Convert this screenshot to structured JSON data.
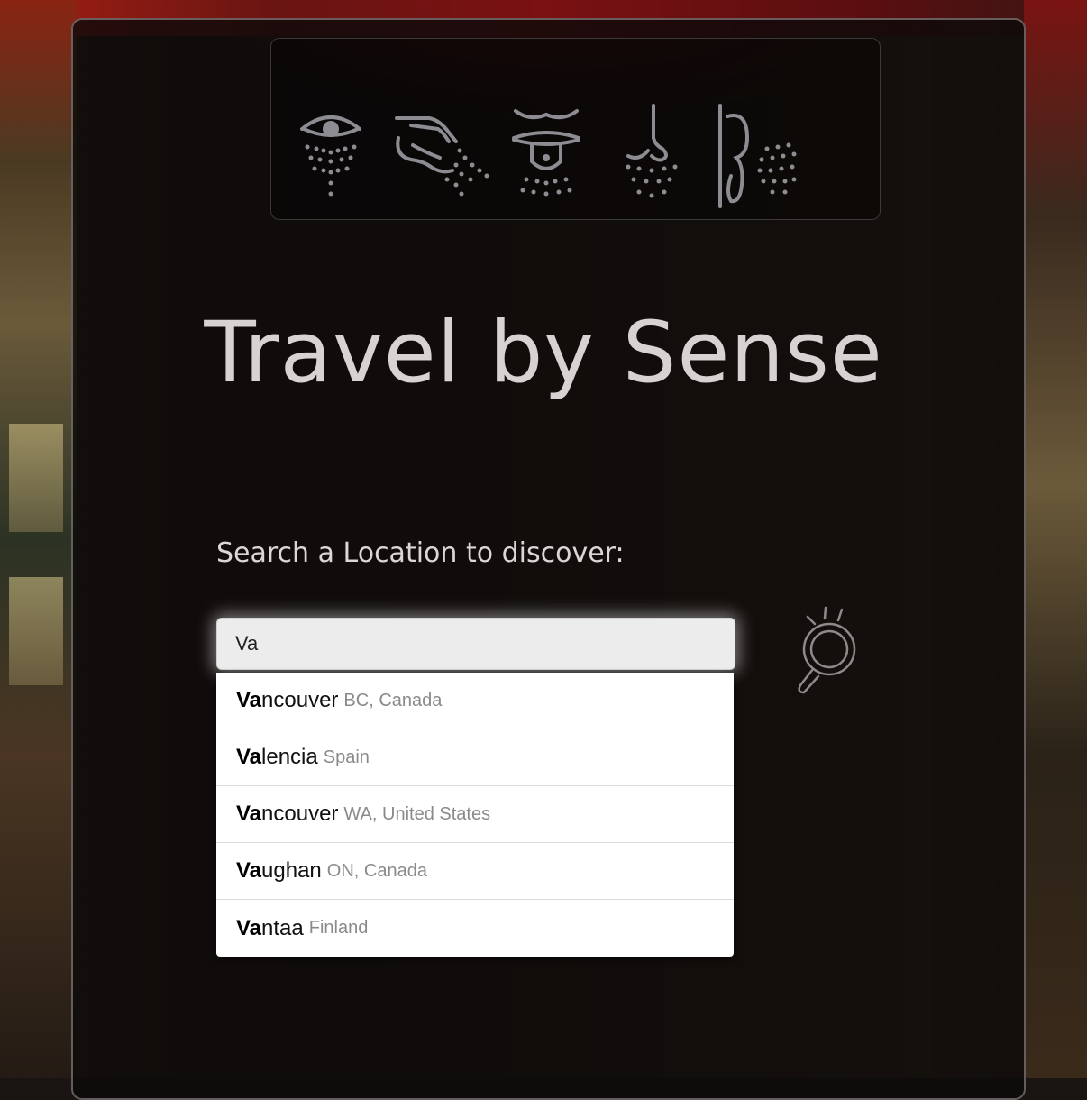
{
  "header": {
    "icons": [
      "sight-icon",
      "touch-icon",
      "taste-icon",
      "smell-icon",
      "hearing-icon"
    ]
  },
  "title": "Travel by Sense",
  "search": {
    "prompt": "Search a Location to discover:",
    "value": "Va",
    "button_icon": "search-icon"
  },
  "suggestions": [
    {
      "match": "Va",
      "rest": "ncouver",
      "detail": "BC, Canada"
    },
    {
      "match": "Va",
      "rest": "lencia",
      "detail": "Spain"
    },
    {
      "match": "Va",
      "rest": "ncouver",
      "detail": "WA, United States"
    },
    {
      "match": "Va",
      "rest": "ughan",
      "detail": "ON, Canada"
    },
    {
      "match": "Va",
      "rest": "ntaa",
      "detail": "Finland"
    }
  ],
  "colors": {
    "icon_gray": "#8c8c92",
    "title": "#d8d2d2"
  }
}
